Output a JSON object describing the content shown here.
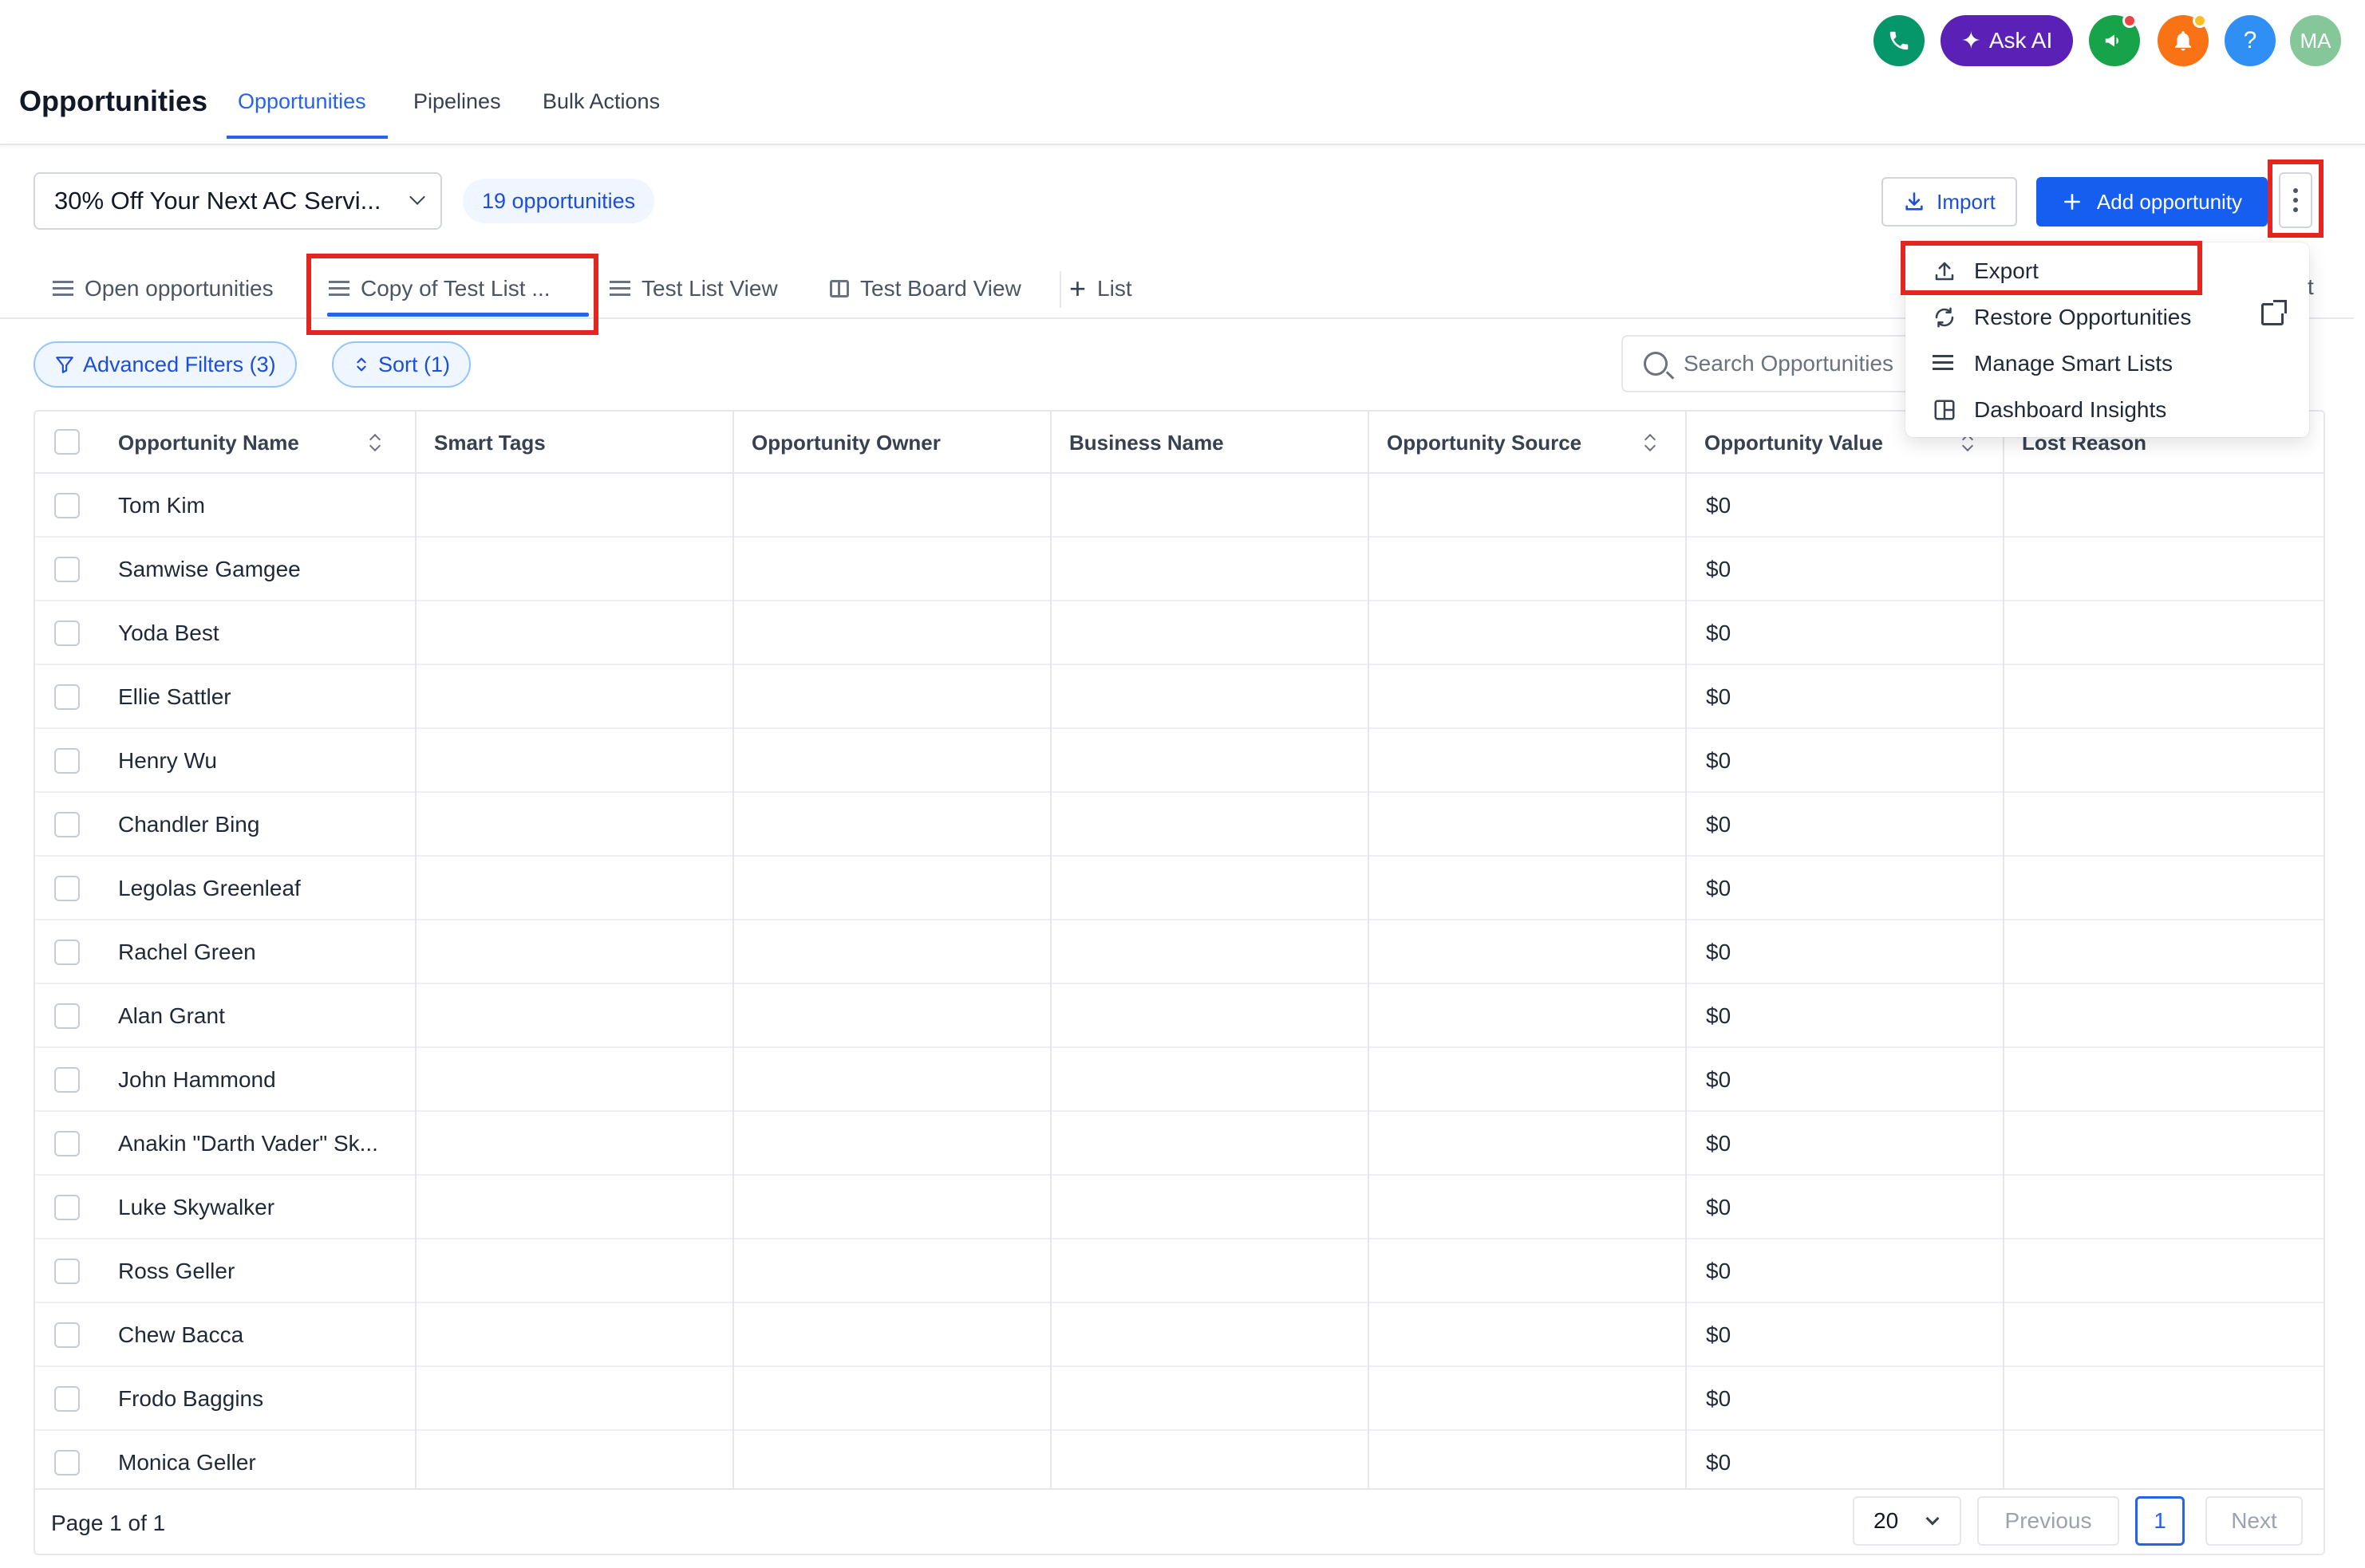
{
  "header": {
    "title": "Opportunities",
    "tabs": [
      {
        "label": "Opportunities",
        "active": true
      },
      {
        "label": "Pipelines",
        "active": false
      },
      {
        "label": "Bulk Actions",
        "active": false
      }
    ],
    "ask_ai_label": "Ask AI",
    "help_glyph": "?",
    "avatar_initials": "MA",
    "icons": [
      "phone-icon",
      "sparkle-icon",
      "megaphone-icon",
      "bell-icon",
      "help-icon"
    ]
  },
  "toolbar": {
    "pipeline_value": "30% Off Your Next AC Servi...",
    "count_label": "19 opportunities",
    "import_label": "Import",
    "add_label": "Add opportunity"
  },
  "views": [
    {
      "label": "Open opportunities",
      "icon": "list-icon"
    },
    {
      "label": "Copy of Test List ...",
      "icon": "list-icon",
      "active": true
    },
    {
      "label": "Test List View",
      "icon": "list-icon"
    },
    {
      "label": "Test Board View",
      "icon": "board-icon"
    },
    {
      "label": "List",
      "icon": "plus-icon"
    }
  ],
  "filters": {
    "advanced_label": "Advanced Filters (3)",
    "sort_label": "Sort (1)",
    "search_placeholder": "Search Opportunities"
  },
  "menu": {
    "items": [
      {
        "label": "Export",
        "icon": "upload-icon"
      },
      {
        "label": "Restore Opportunities",
        "icon": "refresh-icon"
      },
      {
        "label": "Manage Smart Lists",
        "icon": "list-icon"
      },
      {
        "label": "Dashboard Insights",
        "icon": "dashboard-icon"
      }
    ],
    "obscured_tail": "t"
  },
  "table": {
    "columns": [
      "Opportunity Name",
      "Smart Tags",
      "Opportunity Owner",
      "Business Name",
      "Opportunity Source",
      "Opportunity Value",
      "Lost Reason"
    ],
    "rows": [
      {
        "name": "Tom Kim",
        "value": "$0"
      },
      {
        "name": "Samwise Gamgee",
        "value": "$0"
      },
      {
        "name": "Yoda Best",
        "value": "$0"
      },
      {
        "name": "Ellie Sattler",
        "value": "$0"
      },
      {
        "name": "Henry Wu",
        "value": "$0"
      },
      {
        "name": "Chandler Bing",
        "value": "$0"
      },
      {
        "name": "Legolas Greenleaf",
        "value": "$0"
      },
      {
        "name": "Rachel Green",
        "value": "$0"
      },
      {
        "name": "Alan Grant",
        "value": "$0"
      },
      {
        "name": "John Hammond",
        "value": "$0"
      },
      {
        "name": "Anakin \"Darth Vader\" Sk...",
        "value": "$0"
      },
      {
        "name": "Luke Skywalker",
        "value": "$0"
      },
      {
        "name": "Ross Geller",
        "value": "$0"
      },
      {
        "name": "Chew Bacca",
        "value": "$0"
      },
      {
        "name": "Frodo Baggins",
        "value": "$0"
      },
      {
        "name": "Monica Geller",
        "value": "$0"
      }
    ]
  },
  "pagination": {
    "page_label": "Page 1 of 1",
    "page_size": "20",
    "previous_label": "Previous",
    "current_page": "1",
    "next_label": "Next"
  },
  "colors": {
    "accent": "#155eef",
    "highlight": "#e5251f",
    "phone": "#059669",
    "ask_ai": "#5b21b6",
    "megaphone": "#16a34a",
    "bell": "#f97316",
    "help": "#2f8ff5",
    "avatar": "#86c79a"
  }
}
